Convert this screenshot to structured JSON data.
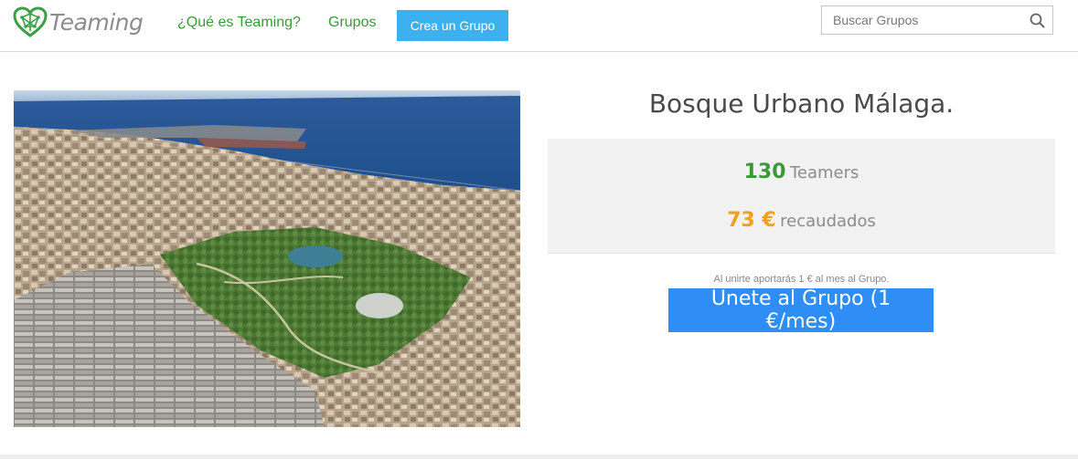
{
  "header": {
    "logo_text": "Teaming",
    "nav": {
      "what_is": "¿Qué es Teaming?",
      "groups": "Grupos",
      "create_group": "Crea un Grupo"
    },
    "search": {
      "placeholder": "Buscar Grupos",
      "value": ""
    }
  },
  "group": {
    "title": "Bosque Urbano Málaga.",
    "image_icon": "aerial-city-park-photo",
    "teamers_count": "130",
    "teamers_label": "Teamers",
    "raised_amount": "73 €",
    "raised_label": "recaudados",
    "join_note": "Al unirte aportarás 1 € al mes al Grupo.",
    "join_button": "Únete al Grupo (1 €/mes)"
  },
  "colors": {
    "green": "#3a9a3a",
    "orange": "#f0a020",
    "create_button": "#3db1ef",
    "join_button": "#2f8ef5"
  }
}
